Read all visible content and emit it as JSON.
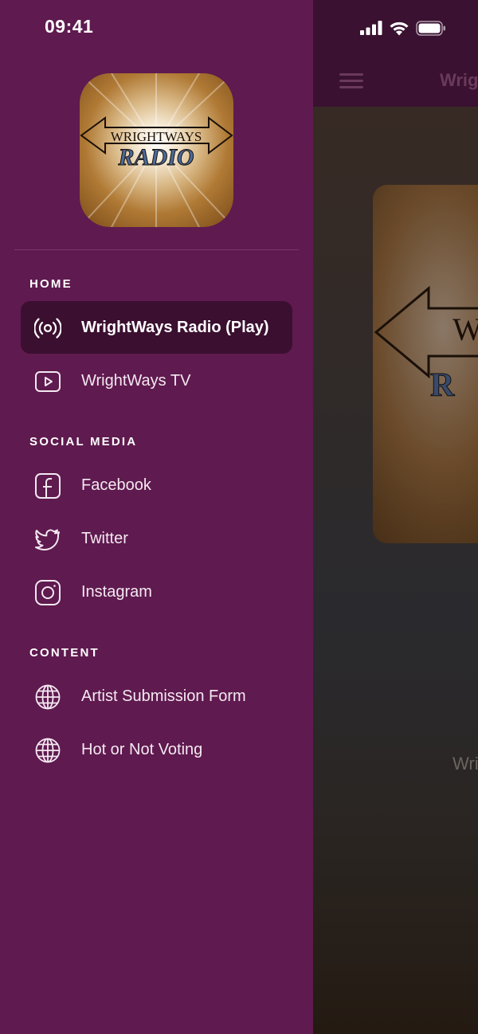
{
  "status_bar": {
    "time": "09:41",
    "icons": [
      "signal-icon",
      "wifi-icon",
      "battery-icon"
    ]
  },
  "logo": {
    "top_text": "WRIGHTWAYS",
    "bottom_text": "RADIO"
  },
  "background": {
    "title": "Wrig",
    "caption": "Wri"
  },
  "sections": {
    "home": "HOME",
    "social": "SOCIAL MEDIA",
    "content": "CONTENT"
  },
  "items": {
    "radio": {
      "label": "WrightWays Radio (Play)",
      "icon": "radio-broadcast-icon",
      "active": true
    },
    "tv": {
      "label": "WrightWays TV",
      "icon": "play-video-icon"
    },
    "facebook": {
      "label": "Facebook",
      "icon": "facebook-icon"
    },
    "twitter": {
      "label": "Twitter",
      "icon": "twitter-icon"
    },
    "instagram": {
      "label": "Instagram",
      "icon": "instagram-icon"
    },
    "artist_form": {
      "label": "Artist Submission Form",
      "icon": "globe-icon"
    },
    "hot_or_not": {
      "label": "Hot or Not Voting",
      "icon": "globe-icon"
    }
  },
  "colors": {
    "drawer": "#5f1a4f",
    "active_item": "#3b0f30",
    "topbar": "#3a1131"
  }
}
